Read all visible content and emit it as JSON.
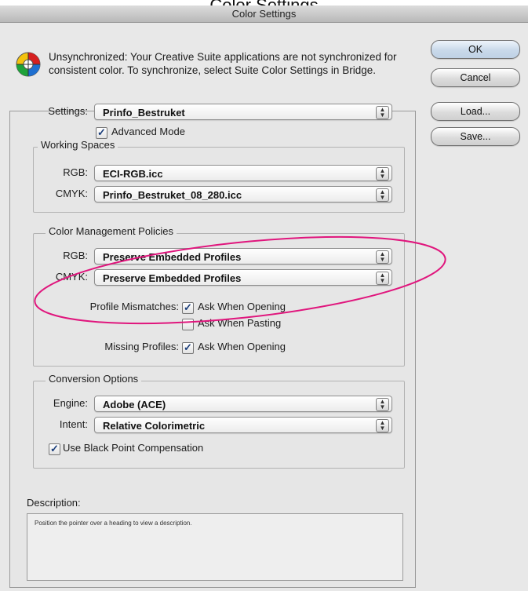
{
  "page_label": "Color Settings",
  "window": {
    "title": "Color Settings"
  },
  "warning": {
    "text": "Unsynchronized: Your Creative Suite applications are not synchronized for consistent color. To synchronize, select Suite Color Settings in Bridge."
  },
  "buttons": {
    "ok": "OK",
    "cancel": "Cancel",
    "load": "Load...",
    "save": "Save..."
  },
  "settings": {
    "label": "Settings:",
    "value": "Prinfo_Bestruket",
    "advanced_mode_label": "Advanced Mode",
    "advanced_mode_checked": true
  },
  "working_spaces": {
    "title": "Working Spaces",
    "rgb_label": "RGB:",
    "rgb_value": "ECI-RGB.icc",
    "cmyk_label": "CMYK:",
    "cmyk_value": "Prinfo_Bestruket_08_280.icc"
  },
  "policies": {
    "title": "Color Management Policies",
    "rgb_label": "RGB:",
    "rgb_value": "Preserve Embedded Profiles",
    "cmyk_label": "CMYK:",
    "cmyk_value": "Preserve Embedded Profiles",
    "mismatch_label": "Profile Mismatches:",
    "ask_opening_label": "Ask When Opening",
    "ask_opening_checked": true,
    "ask_pasting_label": "Ask When Pasting",
    "ask_pasting_checked": false,
    "missing_label": "Missing Profiles:",
    "missing_ask_label": "Ask When Opening",
    "missing_ask_checked": true
  },
  "conversion": {
    "title": "Conversion Options",
    "engine_label": "Engine:",
    "engine_value": "Adobe (ACE)",
    "intent_label": "Intent:",
    "intent_value": "Relative Colorimetric",
    "bpc_label": "Use Black Point Compensation",
    "bpc_checked": true
  },
  "description": {
    "label": "Description:",
    "text": "Position the pointer over a heading to view a description."
  },
  "colors": {
    "annotation": "#e0167d",
    "check": "#1a3d7a"
  }
}
